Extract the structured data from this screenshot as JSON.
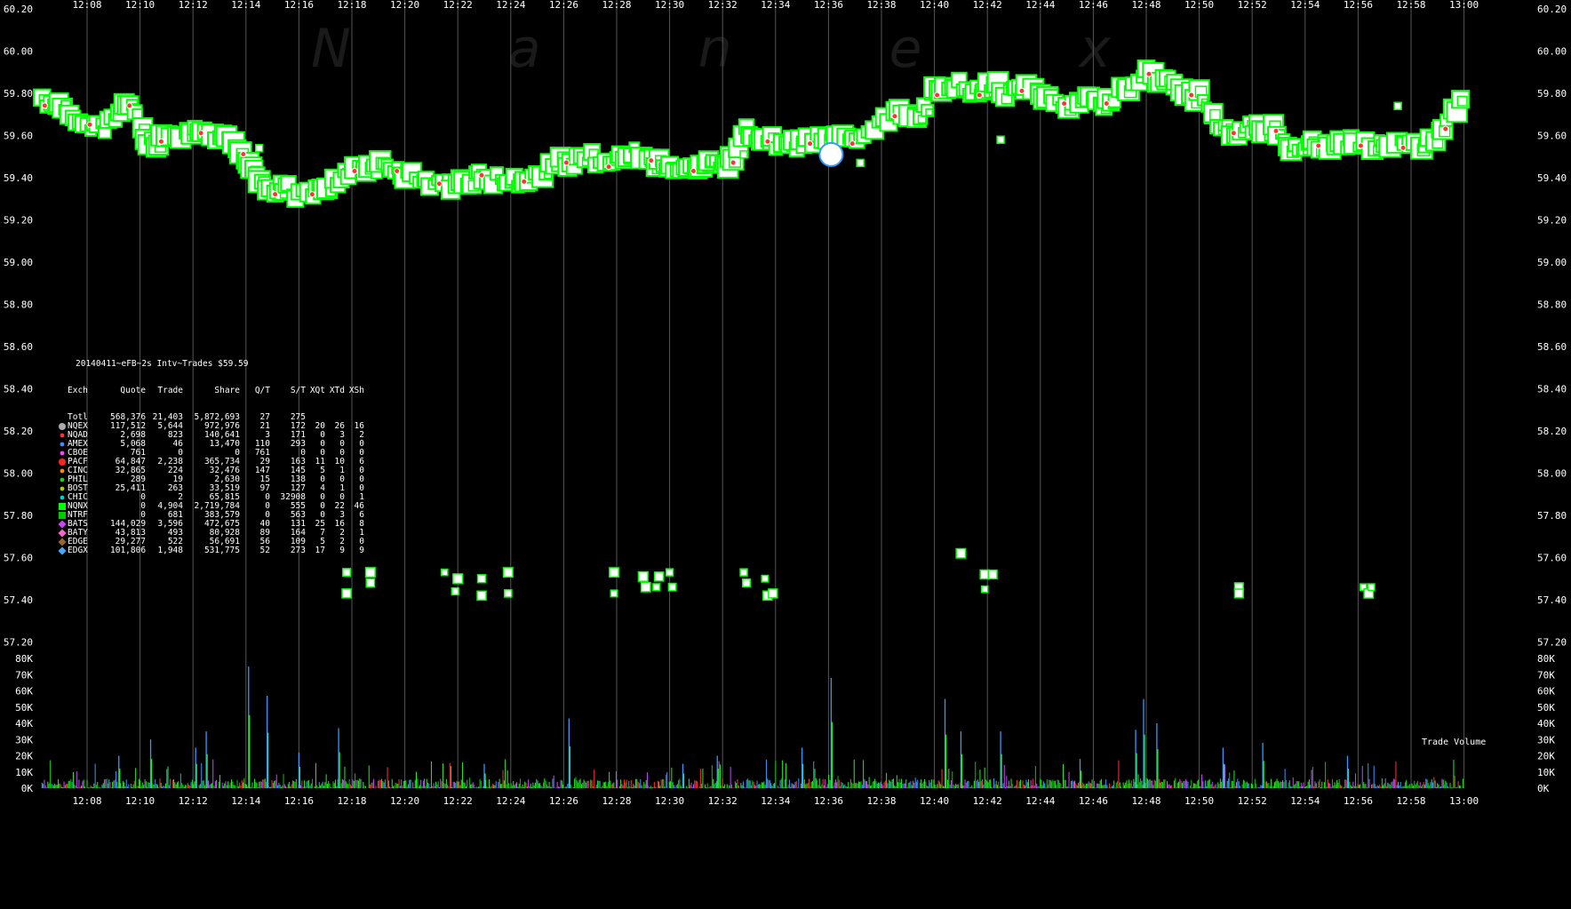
{
  "chart_data": [
    {
      "type": "scatter",
      "title": "20140411~eFB~2s Intv~Trades $59.59",
      "watermark": [
        "N",
        "a",
        "n",
        "e",
        "x"
      ],
      "x_ticks": [
        "12:08",
        "12:10",
        "12:12",
        "12:14",
        "12:16",
        "12:18",
        "12:20",
        "12:22",
        "12:24",
        "12:26",
        "12:28",
        "12:30",
        "12:32",
        "12:34",
        "12:36",
        "12:38",
        "12:40",
        "12:42",
        "12:44",
        "12:46",
        "12:48",
        "12:50",
        "12:52",
        "12:54",
        "12:56",
        "12:58",
        "13:00"
      ],
      "y_ticks": [
        "60.20",
        "60.00",
        "59.80",
        "59.60",
        "59.40",
        "59.20",
        "59.00",
        "58.80",
        "58.60",
        "58.40",
        "58.20",
        "58.00",
        "57.80",
        "57.60",
        "57.40",
        "57.20"
      ],
      "ylim": [
        57.2,
        60.2
      ],
      "xlim_minutes": [
        6.3,
        60
      ],
      "marker_color": "#00ff00",
      "grid": true,
      "price_path": [
        [
          6.3,
          59.75
        ],
        [
          6.8,
          59.76
        ],
        [
          7.2,
          59.73
        ],
        [
          7.6,
          59.69
        ],
        [
          8.0,
          59.66
        ],
        [
          8.4,
          59.63
        ],
        [
          8.8,
          59.65
        ],
        [
          9.2,
          59.7
        ],
        [
          9.5,
          59.75
        ],
        [
          9.8,
          59.72
        ],
        [
          10.1,
          59.62
        ],
        [
          10.4,
          59.56
        ],
        [
          10.7,
          59.58
        ],
        [
          11.0,
          59.6
        ],
        [
          11.4,
          59.61
        ],
        [
          11.8,
          59.6
        ],
        [
          12.2,
          59.62
        ],
        [
          12.6,
          59.6
        ],
        [
          13.0,
          59.59
        ],
        [
          13.4,
          59.58
        ],
        [
          13.8,
          59.52
        ],
        [
          14.1,
          59.46
        ],
        [
          14.4,
          59.42
        ],
        [
          14.7,
          59.36
        ],
        [
          15.0,
          59.33
        ],
        [
          15.3,
          59.36
        ],
        [
          15.6,
          59.35
        ],
        [
          16.0,
          59.32
        ],
        [
          16.4,
          59.33
        ],
        [
          16.8,
          59.35
        ],
        [
          17.2,
          59.36
        ],
        [
          17.6,
          59.4
        ],
        [
          18.0,
          59.44
        ],
        [
          18.4,
          59.45
        ],
        [
          18.8,
          59.43
        ],
        [
          19.2,
          59.46
        ],
        [
          19.6,
          59.44
        ],
        [
          20.0,
          59.42
        ],
        [
          20.4,
          59.4
        ],
        [
          20.8,
          59.39
        ],
        [
          21.2,
          59.38
        ],
        [
          21.6,
          59.37
        ],
        [
          22.0,
          59.36
        ],
        [
          22.4,
          59.38
        ],
        [
          22.8,
          59.42
        ],
        [
          23.2,
          59.4
        ],
        [
          23.6,
          59.39
        ],
        [
          24.0,
          59.38
        ],
        [
          24.4,
          59.39
        ],
        [
          24.8,
          59.41
        ],
        [
          25.2,
          59.43
        ],
        [
          25.6,
          59.46
        ],
        [
          26.0,
          59.48
        ],
        [
          26.4,
          59.47
        ],
        [
          26.8,
          59.5
        ],
        [
          27.2,
          59.49
        ],
        [
          27.6,
          59.46
        ],
        [
          28.0,
          59.48
        ],
        [
          28.4,
          59.52
        ],
        [
          28.8,
          59.53
        ],
        [
          29.2,
          59.49
        ],
        [
          29.6,
          59.47
        ],
        [
          30.0,
          59.45
        ],
        [
          30.4,
          59.45
        ],
        [
          30.8,
          59.44
        ],
        [
          31.2,
          59.45
        ],
        [
          31.6,
          59.46
        ],
        [
          32.0,
          59.45
        ],
        [
          32.3,
          59.48
        ],
        [
          32.6,
          59.57
        ],
        [
          32.9,
          59.63
        ],
        [
          33.2,
          59.6
        ],
        [
          33.6,
          59.58
        ],
        [
          34.0,
          59.56
        ],
        [
          34.4,
          59.58
        ],
        [
          34.8,
          59.56
        ],
        [
          35.2,
          59.57
        ],
        [
          35.6,
          59.58
        ],
        [
          36.0,
          59.59
        ],
        [
          36.4,
          59.58
        ],
        [
          36.8,
          59.57
        ],
        [
          37.2,
          59.6
        ],
        [
          37.6,
          59.63
        ],
        [
          38.0,
          59.67
        ],
        [
          38.4,
          59.7
        ],
        [
          38.8,
          59.7
        ],
        [
          39.2,
          59.69
        ],
        [
          39.6,
          59.72
        ],
        [
          40.0,
          59.8
        ],
        [
          40.4,
          59.84
        ],
        [
          40.8,
          59.85
        ],
        [
          41.2,
          59.82
        ],
        [
          41.6,
          59.8
        ],
        [
          42.0,
          59.84
        ],
        [
          42.4,
          59.83
        ],
        [
          42.8,
          59.8
        ],
        [
          43.2,
          59.82
        ],
        [
          43.6,
          59.82
        ],
        [
          44.0,
          59.8
        ],
        [
          44.4,
          59.77
        ],
        [
          44.8,
          59.76
        ],
        [
          45.2,
          59.75
        ],
        [
          45.6,
          59.76
        ],
        [
          46.0,
          59.78
        ],
        [
          46.4,
          59.76
        ],
        [
          46.8,
          59.79
        ],
        [
          47.2,
          59.82
        ],
        [
          47.6,
          59.86
        ],
        [
          48.0,
          59.9
        ],
        [
          48.4,
          59.87
        ],
        [
          48.8,
          59.84
        ],
        [
          49.2,
          59.82
        ],
        [
          49.6,
          59.8
        ],
        [
          50.0,
          59.79
        ],
        [
          50.4,
          59.7
        ],
        [
          50.8,
          59.65
        ],
        [
          51.2,
          59.62
        ],
        [
          51.6,
          59.63
        ],
        [
          52.0,
          59.64
        ],
        [
          52.4,
          59.62
        ],
        [
          52.8,
          59.63
        ],
        [
          53.2,
          59.58
        ],
        [
          53.6,
          59.55
        ],
        [
          54.0,
          59.54
        ],
        [
          54.4,
          59.56
        ],
        [
          54.8,
          59.55
        ],
        [
          55.2,
          59.54
        ],
        [
          55.6,
          59.57
        ],
        [
          56.0,
          59.56
        ],
        [
          56.4,
          59.54
        ],
        [
          56.8,
          59.57
        ],
        [
          57.2,
          59.56
        ],
        [
          57.6,
          59.55
        ],
        [
          58.0,
          59.54
        ],
        [
          58.4,
          59.56
        ],
        [
          58.8,
          59.58
        ],
        [
          59.2,
          59.64
        ],
        [
          59.6,
          59.72
        ],
        [
          60.0,
          59.76
        ]
      ],
      "odd_lots": [
        [
          17.8,
          57.53
        ],
        [
          18.7,
          57.48
        ],
        [
          17.8,
          57.43
        ],
        [
          18.7,
          57.53
        ],
        [
          21.5,
          57.53
        ],
        [
          21.9,
          57.44
        ],
        [
          22.0,
          57.5
        ],
        [
          22.9,
          57.5
        ],
        [
          22.9,
          57.42
        ],
        [
          23.9,
          57.53
        ],
        [
          23.9,
          57.43
        ],
        [
          27.9,
          57.53
        ],
        [
          27.9,
          57.43
        ],
        [
          29.0,
          57.51
        ],
        [
          29.1,
          57.46
        ],
        [
          29.5,
          57.46
        ],
        [
          29.6,
          57.51
        ],
        [
          30.0,
          57.53
        ],
        [
          30.1,
          57.46
        ],
        [
          32.8,
          57.53
        ],
        [
          32.9,
          57.48
        ],
        [
          33.6,
          57.5
        ],
        [
          33.7,
          57.42
        ],
        [
          33.9,
          57.43
        ],
        [
          41.0,
          57.62
        ],
        [
          41.9,
          57.52
        ],
        [
          42.2,
          57.52
        ],
        [
          41.9,
          57.45
        ],
        [
          51.5,
          57.46
        ],
        [
          51.5,
          57.43
        ],
        [
          56.2,
          57.46
        ],
        [
          56.4,
          57.43
        ],
        [
          56.5,
          57.46
        ]
      ],
      "outliers": [
        [
          14.5,
          59.54
        ],
        [
          32.8,
          59.51
        ],
        [
          36.1,
          59.5
        ],
        [
          42.5,
          59.58
        ],
        [
          57.5,
          59.74
        ],
        [
          37.2,
          59.47
        ]
      ]
    },
    {
      "type": "bar",
      "title": "Trade Volume",
      "y_ticks": [
        "80K",
        "70K",
        "60K",
        "50K",
        "40K",
        "30K",
        "20K",
        "10K",
        "0K"
      ],
      "ylim": [
        0,
        80000
      ],
      "spikes": [
        [
          14.1,
          75000
        ],
        [
          14.8,
          57000
        ],
        [
          12.5,
          35000
        ],
        [
          17.5,
          37000
        ],
        [
          10.4,
          30000
        ],
        [
          9.2,
          20000
        ],
        [
          26.2,
          43000
        ],
        [
          36.1,
          68000
        ],
        [
          40.4,
          55000
        ],
        [
          41.0,
          35000
        ],
        [
          47.9,
          55000
        ],
        [
          47.6,
          36000
        ],
        [
          42.5,
          35000
        ],
        [
          48.4,
          40000
        ],
        [
          50.9,
          25000
        ],
        [
          52.4,
          28000
        ],
        [
          55.6,
          20000
        ],
        [
          35.0,
          25000
        ],
        [
          31.8,
          20000
        ],
        [
          12.1,
          25000
        ],
        [
          16.0,
          22000
        ],
        [
          23.0,
          15000
        ],
        [
          30.5,
          15000
        ],
        [
          45.5,
          18000
        ]
      ]
    }
  ],
  "stats_table": {
    "title": "20140411~eFB~2s Intv~Trades $59.59",
    "headers": [
      "Exch",
      "Quote",
      "Trade",
      "Share",
      "Q/T",
      "S/T",
      "XQt",
      "XTd",
      "XSh"
    ],
    "rows": [
      {
        "color": "",
        "shape": "none",
        "cells": [
          "Totl",
          "568,376",
          "21,403",
          "5,872,693",
          "27",
          "275",
          "",
          "",
          ""
        ]
      },
      {
        "color": "#aaaaaa",
        "shape": "circle",
        "cells": [
          "NQEX",
          "117,512",
          "5,644",
          "972,976",
          "21",
          "172",
          "20",
          "26",
          "16"
        ]
      },
      {
        "color": "#ff3333",
        "shape": "dot",
        "cells": [
          "NQAD",
          "2,698",
          "823",
          "140,641",
          "3",
          "171",
          "0",
          "3",
          "2"
        ]
      },
      {
        "color": "#4488ff",
        "shape": "dot",
        "cells": [
          "AMEX",
          "5,068",
          "46",
          "13,470",
          "110",
          "293",
          "0",
          "0",
          "0"
        ]
      },
      {
        "color": "#ff44ff",
        "shape": "dot",
        "cells": [
          "CBOE",
          "761",
          "0",
          "0",
          "761",
          "0",
          "0",
          "0",
          "0"
        ]
      },
      {
        "color": "#ff2222",
        "shape": "circle",
        "cells": [
          "PACF",
          "64,847",
          "2,238",
          "365,734",
          "29",
          "163",
          "11",
          "10",
          "6"
        ]
      },
      {
        "color": "#ff8800",
        "shape": "dot",
        "cells": [
          "CINC",
          "32,865",
          "224",
          "32,476",
          "147",
          "145",
          "5",
          "1",
          "0"
        ]
      },
      {
        "color": "#22cc22",
        "shape": "dot",
        "cells": [
          "PHIL",
          "289",
          "19",
          "2,630",
          "15",
          "138",
          "0",
          "0",
          "0"
        ]
      },
      {
        "color": "#aacc00",
        "shape": "dot",
        "cells": [
          "BOST",
          "25,411",
          "263",
          "33,519",
          "97",
          "127",
          "4",
          "1",
          "0"
        ]
      },
      {
        "color": "#00cccc",
        "shape": "dot",
        "cells": [
          "CHIC",
          "0",
          "2",
          "65,815",
          "0",
          "32908",
          "0",
          "0",
          "1"
        ]
      },
      {
        "color": "#00ff00",
        "shape": "square",
        "cells": [
          "NQNX",
          "0",
          "4,904",
          "2,719,784",
          "0",
          "555",
          "0",
          "22",
          "46"
        ]
      },
      {
        "color": "#00cc00",
        "shape": "square",
        "cells": [
          "NTRF",
          "0",
          "681",
          "383,579",
          "0",
          "563",
          "0",
          "3",
          "6"
        ]
      },
      {
        "color": "#cc44ff",
        "shape": "diamond",
        "cells": [
          "BATS",
          "144,029",
          "3,596",
          "472,675",
          "40",
          "131",
          "25",
          "16",
          "8"
        ]
      },
      {
        "color": "#ff66cc",
        "shape": "diamond",
        "cells": [
          "BATY",
          "43,813",
          "493",
          "80,928",
          "89",
          "164",
          "7",
          "2",
          "1"
        ]
      },
      {
        "color": "#996633",
        "shape": "diamond",
        "cells": [
          "EDGE",
          "29,277",
          "522",
          "56,691",
          "56",
          "109",
          "5",
          "2",
          "0"
        ]
      },
      {
        "color": "#44aaff",
        "shape": "diamond",
        "cells": [
          "EDGX",
          "101,806",
          "1,948",
          "531,775",
          "52",
          "273",
          "17",
          "9",
          "9"
        ]
      }
    ]
  },
  "volume_label": "Trade Volume"
}
